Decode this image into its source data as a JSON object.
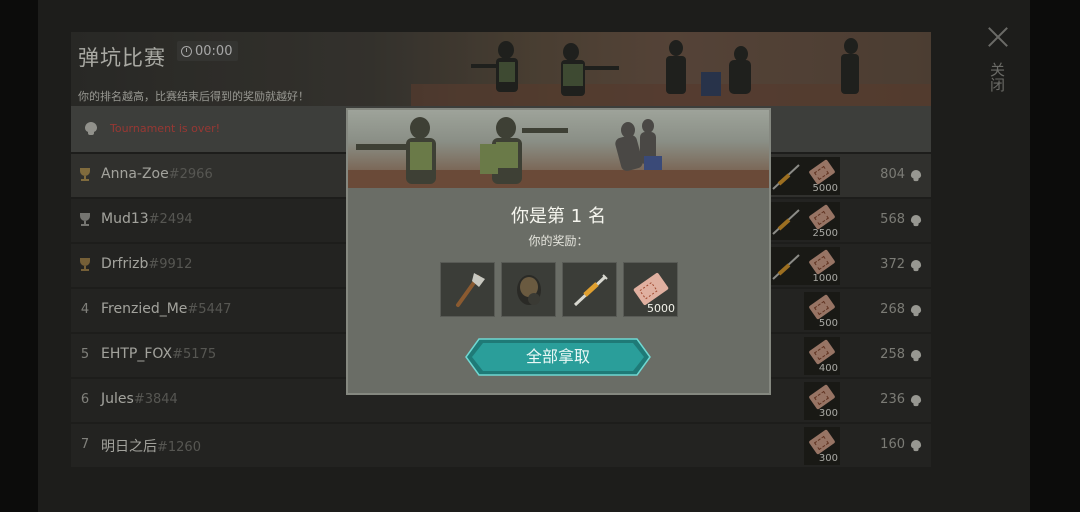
{
  "header": {
    "title": "弹坑比赛",
    "timer": "00:00",
    "subtitle": "你的排名越高，比赛结束后得到的奖励就越好！"
  },
  "banner": {
    "text": "Tournament is over!"
  },
  "close": {
    "label": "关闭"
  },
  "leaderboard": [
    {
      "rank": "",
      "trophy": "gold",
      "name": "Anna-Zoe",
      "tag": "#2966",
      "reward": "5000",
      "score": "804"
    },
    {
      "rank": "",
      "trophy": "silver",
      "name": "Mud13",
      "tag": "#2494",
      "reward": "2500",
      "score": "568"
    },
    {
      "rank": "",
      "trophy": "bronze",
      "name": "Drfrizb",
      "tag": "#9912",
      "reward": "1000",
      "score": "372"
    },
    {
      "rank": "4",
      "trophy": "",
      "name": "Frenzied_Me",
      "tag": "#5447",
      "reward": "500",
      "score": "268"
    },
    {
      "rank": "5",
      "trophy": "",
      "name": "EHTP_FOX",
      "tag": "#5175",
      "reward": "400",
      "score": "258"
    },
    {
      "rank": "6",
      "trophy": "",
      "name": "Jules",
      "tag": "#3844",
      "reward": "300",
      "score": "236"
    },
    {
      "rank": "7",
      "trophy": "",
      "name": "明日之后",
      "tag": "#1260",
      "reward": "300",
      "score": "160"
    }
  ],
  "modal": {
    "title": "你是第 1 名",
    "subtitle": "你的奖励：",
    "items": [
      {
        "icon": "axe-icon"
      },
      {
        "icon": "gas-mask-icon"
      },
      {
        "icon": "syringe-icon"
      },
      {
        "icon": "ticket-icon",
        "count": "5000"
      }
    ],
    "button": "全部拿取"
  },
  "colors": {
    "accent": "#2a9e9a",
    "alert": "#d8504a",
    "gold": "#b89a58"
  }
}
